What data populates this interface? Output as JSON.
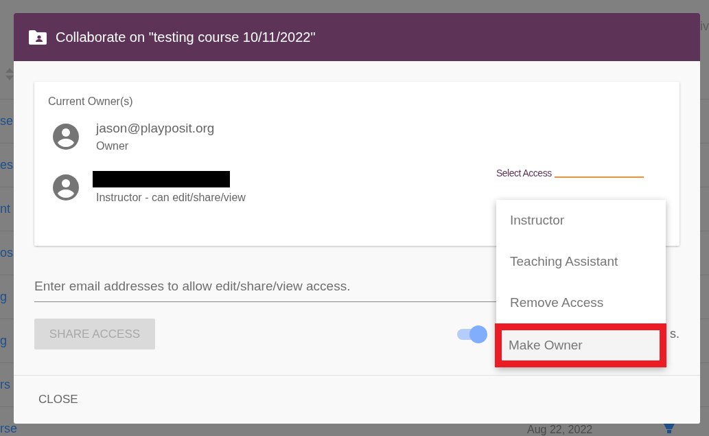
{
  "background": {
    "header_text": "iv",
    "rows": [
      {
        "link": "se"
      },
      {
        "link": "es"
      },
      {
        "link": "nt"
      },
      {
        "link": "os"
      },
      {
        "link": "g"
      },
      {
        "link": "g"
      },
      {
        "link": "rs"
      },
      {
        "link": "rse",
        "date": "Aug 22, 2022"
      }
    ]
  },
  "dialog": {
    "title": "Collaborate on \"testing course 10/11/2022\"",
    "owners_heading": "Current Owner(s)",
    "owners": [
      {
        "kind": "email",
        "email": "jason@playposit.org",
        "role": "Owner"
      },
      {
        "kind": "redacted",
        "role": "Instructor - can edit/share/view",
        "select_label": "Select Access"
      }
    ],
    "access_menu": [
      {
        "label": "Instructor",
        "highlighted": false
      },
      {
        "label": "Teaching Assistant",
        "highlighted": false
      },
      {
        "label": "Remove Access",
        "highlighted": false
      },
      {
        "label": "Make Owner",
        "highlighted": true
      }
    ],
    "email_field": {
      "placeholder": "Enter email addresses to allow edit/share/view access."
    },
    "share_button": {
      "label": "SHARE ACCESS",
      "disabled": true
    },
    "toggle": {
      "on": true,
      "label": "s."
    },
    "close_button": "CLOSE"
  }
}
